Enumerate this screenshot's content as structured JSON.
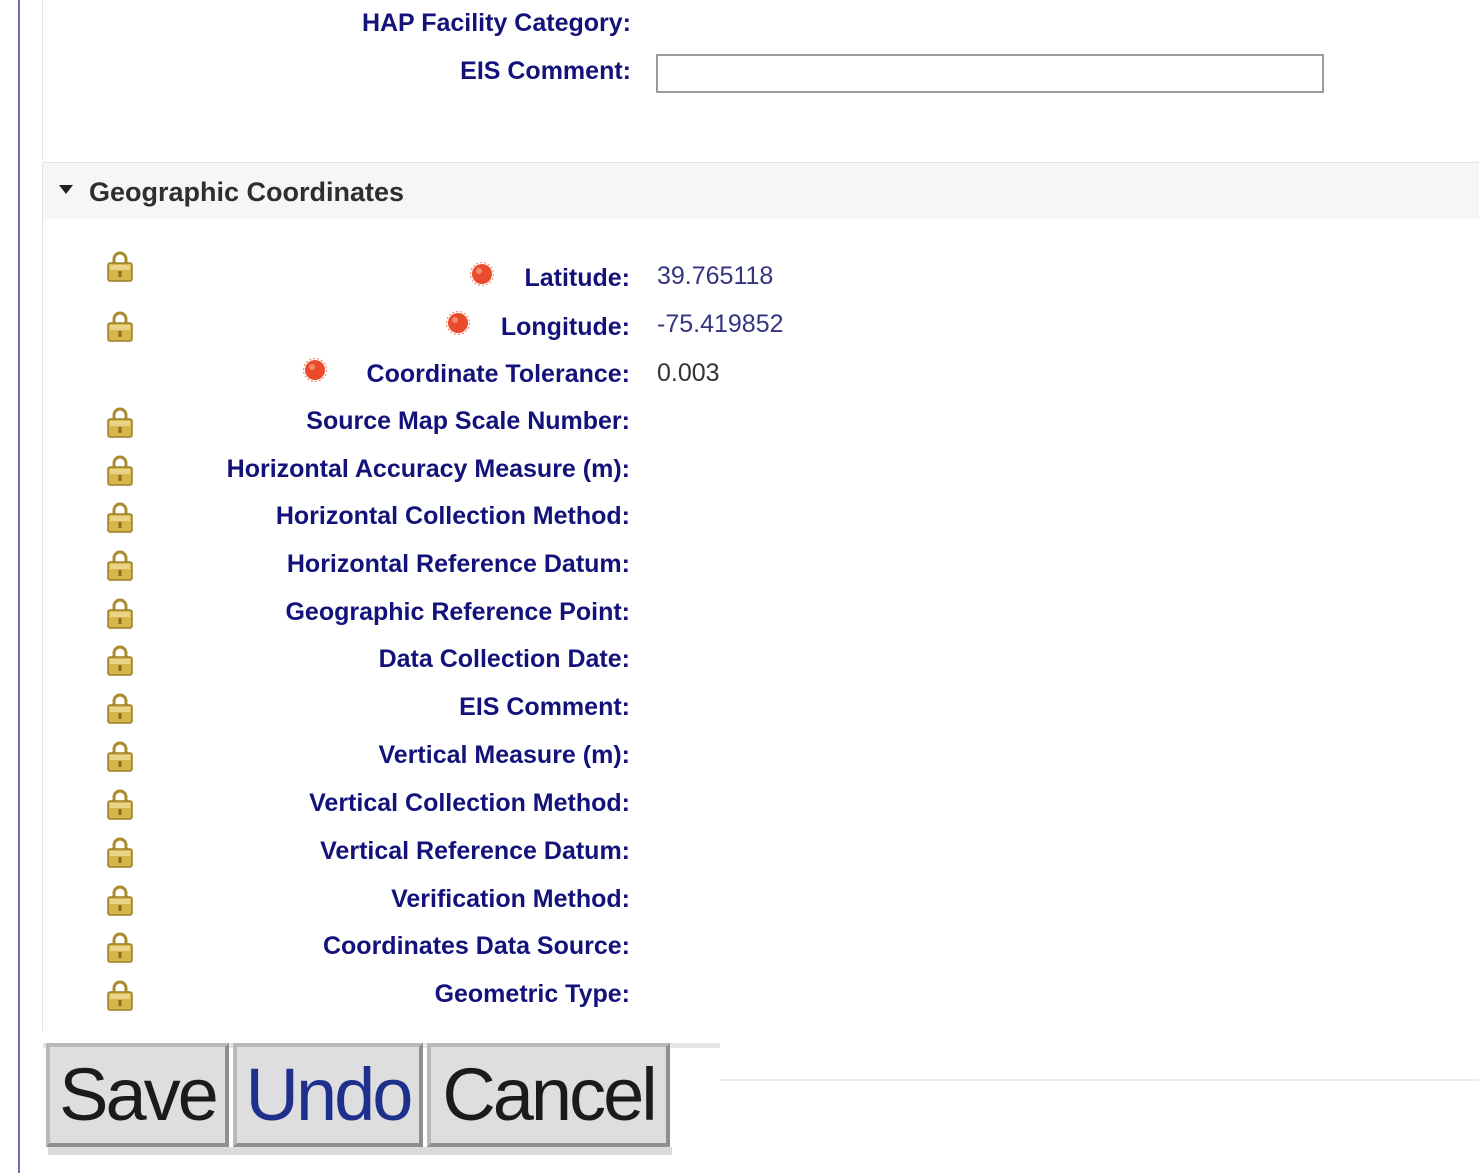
{
  "top_fields": {
    "hap_label": "HAP Facility Category:",
    "eis_comment_label": "EIS Comment:",
    "eis_comment_value": ""
  },
  "section": {
    "title": "Geographic Coordinates",
    "fields": {
      "latitude": {
        "label": "Latitude:",
        "value": "39.765118"
      },
      "longitude": {
        "label": "Longitude:",
        "value": "-75.419852"
      },
      "tolerance": {
        "label": "Coordinate Tolerance:",
        "value": "0.003"
      },
      "source_map_scale": {
        "label": "Source Map Scale Number:"
      },
      "horizontal_accuracy": {
        "label": "Horizontal Accuracy Measure (m):"
      },
      "horizontal_collection": {
        "label": "Horizontal Collection Method:"
      },
      "horizontal_datum": {
        "label": "Horizontal Reference Datum:"
      },
      "geo_ref_point": {
        "label": "Geographic Reference Point:"
      },
      "data_collection_date": {
        "label": "Data Collection Date:"
      },
      "eis_comment": {
        "label": "EIS Comment:"
      },
      "vertical_measure": {
        "label": "Vertical Measure (m):"
      },
      "vertical_collection": {
        "label": "Vertical Collection Method:"
      },
      "vertical_datum": {
        "label": "Vertical Reference Datum:"
      },
      "verification_method": {
        "label": "Verification Method:"
      },
      "coordinates_source": {
        "label": "Coordinates Data Source:"
      },
      "geometric_type": {
        "label": "Geometric Type:"
      }
    }
  },
  "buttons": {
    "save": "Save",
    "undo": "Undo",
    "cancel": "Cancel"
  },
  "icons": {
    "lock": "lock-icon",
    "required": "required-indicator-icon"
  },
  "colors": {
    "label": "#12127a",
    "required": "#ea4b2c",
    "lock": "#c9a93f"
  }
}
